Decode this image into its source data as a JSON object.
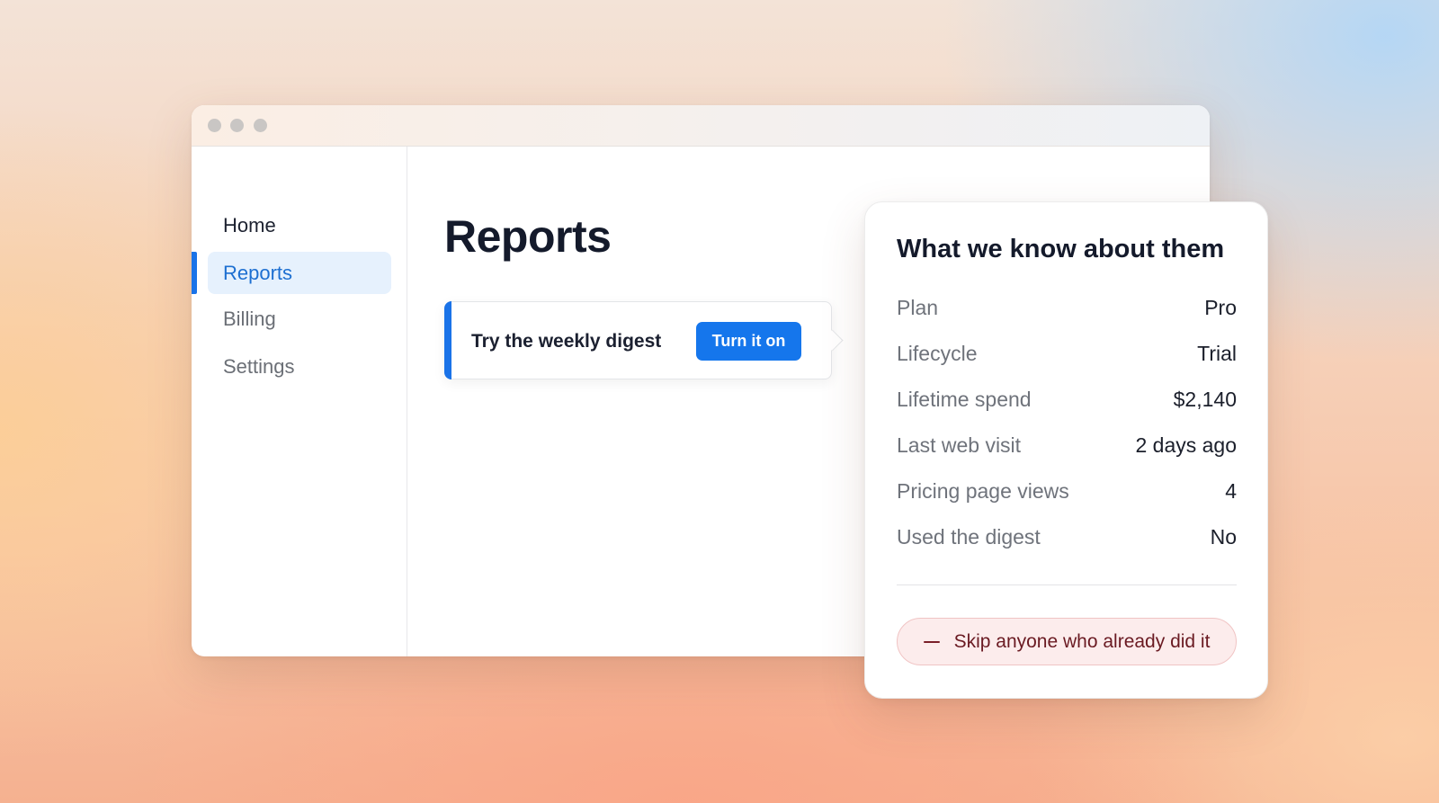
{
  "window": {
    "controls": [
      "dot",
      "dot",
      "dot"
    ]
  },
  "sidebar": {
    "items": [
      {
        "label": "Home",
        "active": false
      },
      {
        "label": "Reports",
        "active": true
      },
      {
        "label": "Billing",
        "active": false
      },
      {
        "label": "Settings",
        "active": false
      }
    ]
  },
  "main": {
    "title": "Reports",
    "digest_card": {
      "text": "Try the weekly digest",
      "button_label": "Turn it on"
    }
  },
  "info_panel": {
    "title": "What we know about them",
    "rows": [
      {
        "label": "Plan",
        "value": "Pro"
      },
      {
        "label": "Lifecycle",
        "value": "Trial"
      },
      {
        "label": "Lifetime spend",
        "value": "$2,140"
      },
      {
        "label": "Last web visit",
        "value": "2 days ago"
      },
      {
        "label": "Pricing page views",
        "value": "4"
      },
      {
        "label": "Used the digest",
        "value": "No"
      }
    ],
    "exclusion_rule": {
      "icon": "minus-icon",
      "label": "Skip anyone who already did it"
    }
  },
  "colors": {
    "accent": "#1a73e8",
    "active_nav_bg": "#e6f1fd",
    "exclusion_bg": "#fcecec",
    "exclusion_text": "#6a1a22"
  }
}
